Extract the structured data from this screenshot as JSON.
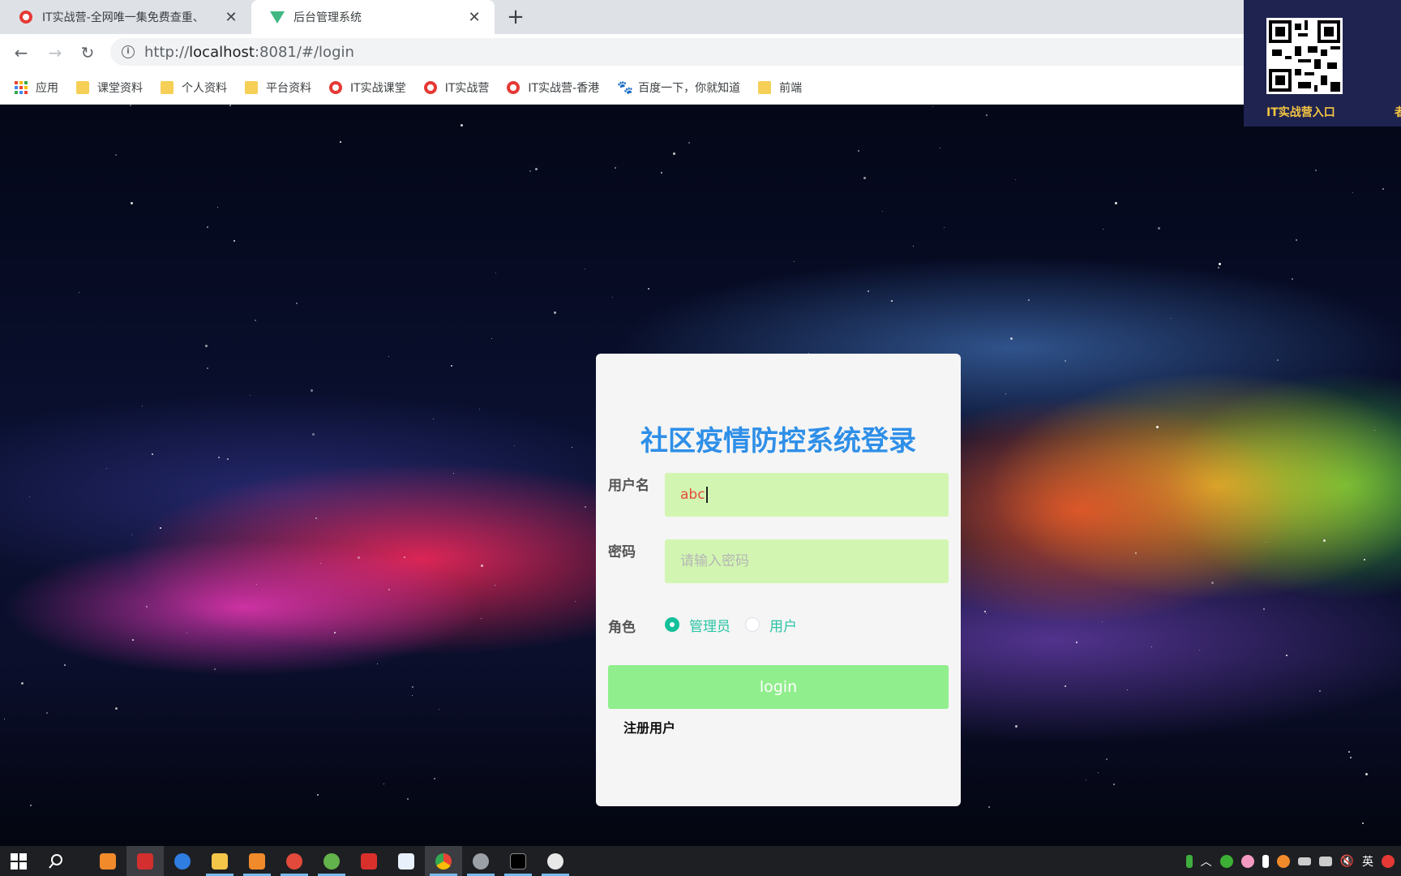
{
  "browser": {
    "tabs": [
      {
        "title": "IT实战营-全网唯一集免费查重、",
        "active": false
      },
      {
        "title": "后台管理系统",
        "active": true
      }
    ],
    "new_tab_symbol": "+",
    "close_symbol": "✕",
    "url": {
      "scheme": "http://",
      "host": "localhost",
      "path": ":8081/#/login"
    },
    "bookmarks": [
      {
        "label": "应用",
        "icon": "apps-grid-icon"
      },
      {
        "label": "课堂资料",
        "icon": "folder-icon"
      },
      {
        "label": "个人资料",
        "icon": "folder-icon"
      },
      {
        "label": "平台资料",
        "icon": "folder-icon"
      },
      {
        "label": "IT实战课堂",
        "icon": "site-favicon-icon"
      },
      {
        "label": "IT实战营",
        "icon": "site-favicon-icon"
      },
      {
        "label": "IT实战营-香港",
        "icon": "site-favicon-icon"
      },
      {
        "label": "百度一下，你就知道",
        "icon": "baidu-paw-icon"
      },
      {
        "label": "前端",
        "icon": "folder-icon"
      }
    ]
  },
  "overlay": {
    "qr_label": "IT实战营入口",
    "qr_label_partial": "者"
  },
  "login": {
    "title": "社区疫情防控系统登录",
    "username_label": "用户名",
    "username_value": "abc",
    "password_label": "密码",
    "password_placeholder": "请输入密码",
    "role_label": "角色",
    "roles": [
      {
        "label": "管理员",
        "selected": true
      },
      {
        "label": "用户",
        "selected": false
      }
    ],
    "login_button": "login",
    "register_link": "注册用户"
  },
  "taskbar": {
    "tray_ime": "英"
  },
  "colors": {
    "title": "#2e8fe8",
    "field_bg": "#d2f6b1",
    "input_text": "#e84b3a",
    "radio_active": "#13c09a",
    "radio_text": "#2ac4a4",
    "login_button": "#90ee8c",
    "card_bg": "#f5f5f5"
  }
}
